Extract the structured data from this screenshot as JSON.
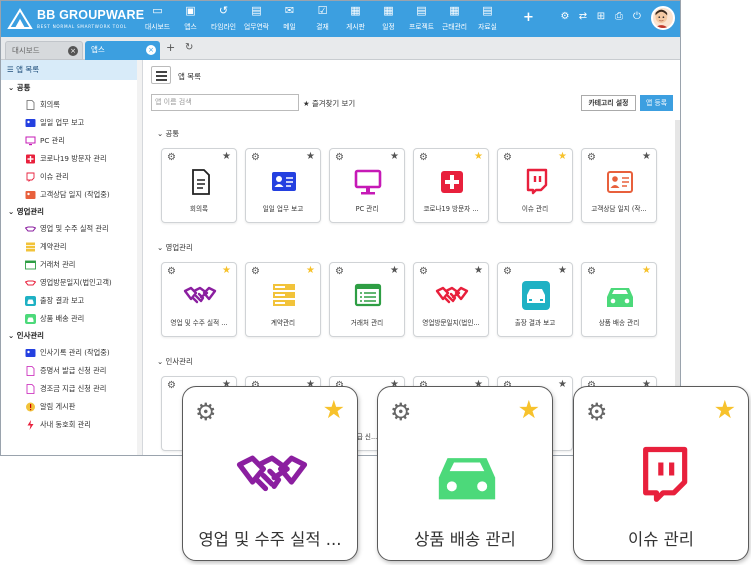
{
  "app": {
    "name": "BB GROUPWARE",
    "tagline": "BEST NORMAL SMARTWORK TOOL"
  },
  "nav": [
    "대시보드",
    "앱스",
    "타임라인",
    "업무연락",
    "메일",
    "결재",
    "게시판",
    "일정",
    "프로젝트",
    "근태관리",
    "자료실"
  ],
  "nav_icons": [
    "monitor-icon",
    "apps-icon",
    "history-icon",
    "message-icon",
    "mail-icon",
    "check-icon",
    "board-icon",
    "calendar-icon",
    "project-icon",
    "attendance-icon",
    "archive-icon"
  ],
  "tabs": [
    {
      "label": "대시보드"
    },
    {
      "label": "앱스"
    }
  ],
  "sidebar": {
    "header": "앱 목록",
    "groups": [
      {
        "label": "공통",
        "items": [
          "회의록",
          "일일 업무 보고",
          "PC 관리",
          "코로나19 방문자 관리",
          "이슈 관리",
          "고객상담 일지 (작업중)"
        ]
      },
      {
        "label": "영업관리",
        "items": [
          "영업 및 수주 실적 관리",
          "계약관리",
          "거래처 관리",
          "영업방문일지(법인고객)",
          "출장 결과 보고",
          "상품 배송 관리"
        ]
      },
      {
        "label": "인사관리",
        "items": [
          "인사기록 관리 (작업중)",
          "증명서 발급 신청 관리",
          "경조금 지급 신청 관리",
          "알림 게시판",
          "사내 동호회 관리"
        ]
      }
    ]
  },
  "main": {
    "title": "앱 목록",
    "search_placeholder": "앱 이름 검색",
    "favorites_label": "즐겨찾기 보기",
    "category_button": "카테고리 설정",
    "register_button": "앱 등록",
    "sections": [
      {
        "title": "공통",
        "apps": [
          {
            "label": "회의록",
            "fav": false
          },
          {
            "label": "일일 업무 보고",
            "fav": false
          },
          {
            "label": "PC 관리",
            "fav": false
          },
          {
            "label": "코로나19 방문자 ...",
            "fav": true
          },
          {
            "label": "이슈 관리",
            "fav": true
          },
          {
            "label": "고객상담 일지 (작...",
            "fav": false
          }
        ]
      },
      {
        "title": "영업관리",
        "apps": [
          {
            "label": "영업 및 수주 실적 ...",
            "fav": true
          },
          {
            "label": "계약관리",
            "fav": true
          },
          {
            "label": "거래처 관리",
            "fav": false
          },
          {
            "label": "영업방문일지(법인...",
            "fav": false
          },
          {
            "label": "출장 결과 보고",
            "fav": false
          },
          {
            "label": "상품 배송 관리",
            "fav": true
          }
        ]
      },
      {
        "title": "인사관리",
        "apps": [
          {
            "label": "인사기...",
            "fav": false
          },
          {
            "label": "",
            "fav": false
          },
          {
            "label": "급 신...",
            "fav": false
          },
          {
            "label": "",
            "fav": false
          },
          {
            "label": "",
            "fav": false
          },
          {
            "label": "",
            "fav": false
          }
        ]
      }
    ]
  },
  "zoom": [
    {
      "label": "영업 및 수주 실적 ...",
      "icon": "handshake-icon",
      "color": "#8b1fa0"
    },
    {
      "label": "상품 배송 관리",
      "icon": "car-icon",
      "color": "#4cd97a"
    },
    {
      "label": "이슈 관리",
      "icon": "twitch-icon",
      "color": "#e8203c"
    }
  ],
  "colors": {
    "accent": "#3c9fe0",
    "star": "#f7c22c"
  }
}
